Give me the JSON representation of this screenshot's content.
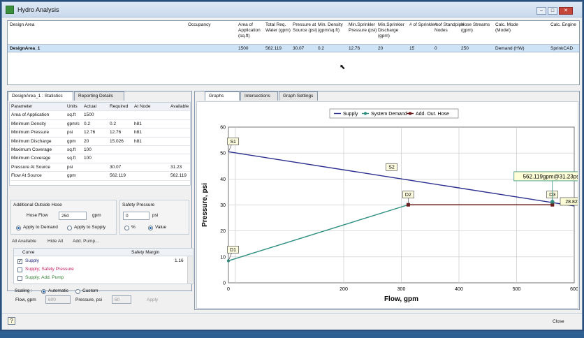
{
  "window": {
    "title": "Hydro Analysis"
  },
  "grid": {
    "headers": [
      "Design Area",
      "Occupancy",
      "Area of Application (sq.ft)",
      "Total Req. Water (gpm)",
      "Pressure at Source (psi)",
      "Min. Density (gpm/sq.ft)",
      "Min.Sprinkler Pressure (psi)",
      "Min.Sprinkler Discharge (gpm)",
      "# of Sprinklers",
      "# of Standpipe Nodes",
      "Hose Streams (gpm)",
      "Calc. Mode (Model)",
      "Calc. Engine"
    ],
    "row": [
      "DesignArea_1",
      "",
      "1500",
      "562.119",
      "30.07",
      "0.2",
      "12.76",
      "20",
      "15",
      "0",
      "250",
      "Demand (HW)",
      "SprinkCAD"
    ]
  },
  "left_tabs": [
    "DesignArea_1 : Statistics",
    "Reporting Details"
  ],
  "stats": {
    "headers": [
      "Parameter",
      "Units",
      "Actual",
      "Required",
      "At Node",
      "Available"
    ],
    "rows": [
      [
        "Area of Application",
        "sq.ft",
        "1500",
        "",
        "",
        ""
      ],
      [
        "Minimum Density",
        "gpm/s",
        "0.2",
        "0.2",
        "h81",
        ""
      ],
      [
        "Minimum Pressure",
        "psi",
        "12.76",
        "12.76",
        "h81",
        ""
      ],
      [
        "Minimum Discharge",
        "gpm",
        "20",
        "15.026",
        "h81",
        ""
      ],
      [
        "Maximum Coverage",
        "sq.ft",
        "100",
        "",
        "",
        ""
      ],
      [
        "Minimum Coverage",
        "sq.ft",
        "100",
        "",
        "",
        ""
      ],
      [
        "Pressure At Source",
        "psi",
        "",
        "30.07",
        "",
        "31.23"
      ],
      [
        "Flow At Source",
        "gpm",
        "",
        "562.119",
        "",
        "562.119"
      ]
    ]
  },
  "hose": {
    "group_label": "Additional Outside Hose",
    "flow_label": "Hose Flow",
    "flow_value": "250",
    "flow_unit": "gpm",
    "apply_demand": "Apply to Demand",
    "apply_supply": "Apply to Supply"
  },
  "safety": {
    "group_label": "Safety Pressure",
    "value": "0",
    "unit": "psi",
    "pct": "%",
    "val": "Value"
  },
  "curve_links": [
    "All Available",
    "Hide All",
    "Add. Pump..."
  ],
  "curves": {
    "headers": [
      "Curve",
      "Safety Margin"
    ],
    "items": [
      {
        "name": "Supply",
        "margin": "1.16",
        "checked": true,
        "color": "#1a237e"
      },
      {
        "name": "Supply; Safety Pressure",
        "margin": "",
        "checked": false,
        "color": "#c2185b"
      },
      {
        "name": "Supply; Add. Pump",
        "margin": "",
        "checked": false,
        "color": "#2e7d32"
      }
    ]
  },
  "scaling": {
    "label": "Scaling :",
    "automatic": "Automatic",
    "custom": "Custom",
    "flow_label": "Flow, gpm",
    "flow_value": "600",
    "pressure_label": "Pressure, psi",
    "pressure_value": "60",
    "apply": "Apply"
  },
  "right_tabs": [
    "Graphs",
    "Intersections",
    "Graph Settings"
  ],
  "chart_data": {
    "type": "line",
    "xlabel": "Flow, gpm",
    "ylabel": "Pressure, psi",
    "xlim": [
      0,
      600
    ],
    "ylim": [
      0,
      60
    ],
    "xticks": [
      0,
      200,
      400,
      600
    ],
    "xticks_minor": [
      300,
      500
    ],
    "yticks": [
      0,
      10,
      20,
      30,
      40,
      50,
      60
    ],
    "legend": [
      "Supply",
      "System Demand",
      "Add. Out. Hose"
    ],
    "series": [
      {
        "name": "Supply",
        "color": "#2b2f8f",
        "x": [
          0,
          600
        ],
        "y": [
          50.5,
          29.6
        ]
      },
      {
        "name": "System Demand",
        "color": "#2f8f80",
        "x": [
          0,
          312
        ],
        "y": [
          8.5,
          30.07
        ]
      },
      {
        "name": "Add. Out. Hose",
        "color": "#6b1b1b",
        "x": [
          312,
          562.119
        ],
        "y": [
          30.07,
          30.07
        ]
      }
    ],
    "markers": [
      {
        "label": "S1",
        "x": 0,
        "y": 50.5,
        "lx": 8,
        "ly": 54.5
      },
      {
        "label": "S2",
        "x": 283,
        "y": 44.6,
        "lx": 283,
        "ly": 44.6
      },
      {
        "label": "D1",
        "x": 0,
        "y": 8.5,
        "lx": 8,
        "ly": 12.8
      },
      {
        "label": "D2",
        "x": 312,
        "y": 30.07,
        "lx": 312,
        "ly": 34
      },
      {
        "label": "D3",
        "x": 562.119,
        "y": 30.07,
        "lx": 562,
        "ly": 34
      }
    ],
    "callout": {
      "text": "562.119gpm@31.23psi",
      "x": 562.119,
      "y": 31.23
    },
    "right_label": "28.828"
  },
  "footer": {
    "close": "Close"
  }
}
